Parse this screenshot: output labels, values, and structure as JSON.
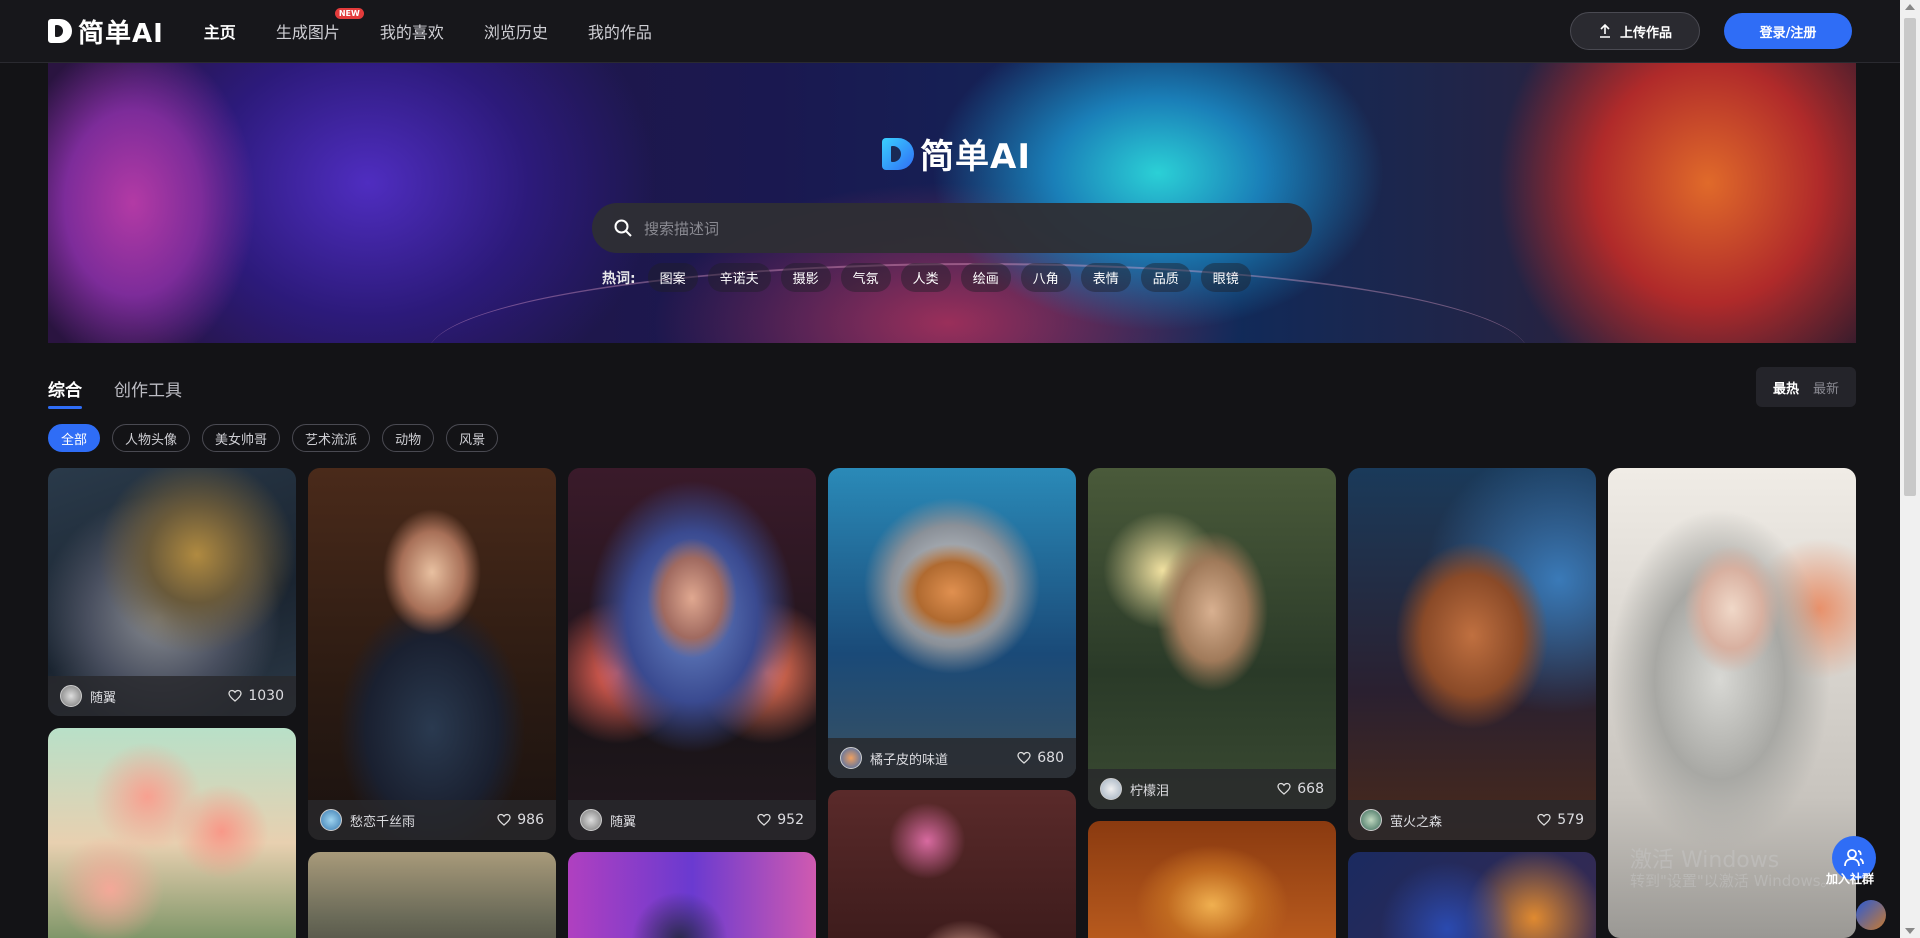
{
  "header": {
    "logo_text": "简单AI",
    "nav": [
      {
        "label": "主页",
        "active": true
      },
      {
        "label": "生成图片",
        "badge": "NEW"
      },
      {
        "label": "我的喜欢"
      },
      {
        "label": "浏览历史"
      },
      {
        "label": "我的作品"
      }
    ],
    "upload_label": "上传作品",
    "login_label": "登录/注册"
  },
  "hero": {
    "logo_text": "简单AI",
    "search_placeholder": "搜索描述词",
    "hot_label": "热词:",
    "hot_tags": [
      "图案",
      "辛诺夫",
      "摄影",
      "气氛",
      "人类",
      "绘画",
      "八角",
      "表情",
      "品质",
      "眼镜"
    ]
  },
  "tabs": [
    {
      "label": "综合",
      "active": true
    },
    {
      "label": "创作工具"
    }
  ],
  "sort": {
    "hot": "最热",
    "new": "最新"
  },
  "filters": [
    {
      "label": "全部",
      "active": true
    },
    {
      "label": "人物头像"
    },
    {
      "label": "美女帅哥"
    },
    {
      "label": "艺术流派"
    },
    {
      "label": "动物"
    },
    {
      "label": "风景"
    }
  ],
  "cards": [
    {
      "author": "随翼",
      "likes": "1030",
      "image": "old-wizard"
    },
    {
      "author": "愁恋千丝雨",
      "likes": "986",
      "image": "gothic-lady"
    },
    {
      "author": "随翼",
      "likes": "952",
      "image": "blue-hair-warrior"
    },
    {
      "author": "橘子皮的味道",
      "likes": "680",
      "image": "astronaut-kitten"
    },
    {
      "author": "柠檬泪",
      "likes": "668",
      "image": "sparkle-face"
    },
    {
      "author": "萤火之森",
      "likes": "579",
      "image": "puppy"
    },
    {
      "image": "silver-hair-girl"
    },
    {
      "image": "pink-flowers"
    },
    {
      "image": "misty-landscape"
    },
    {
      "image": "neon-portrait"
    },
    {
      "image": "flower-crown-girl"
    },
    {
      "image": "golden-ornament"
    },
    {
      "image": "blue-orange-swirl"
    }
  ],
  "floating": {
    "community_label": "加入社群",
    "watermark_line1": "激活 Windows",
    "watermark_line2": "转到\"设置\"以激活 Windows。"
  },
  "colors": {
    "accent": "#2f6df6",
    "background": "#131316",
    "badge": "#e33b3b"
  }
}
